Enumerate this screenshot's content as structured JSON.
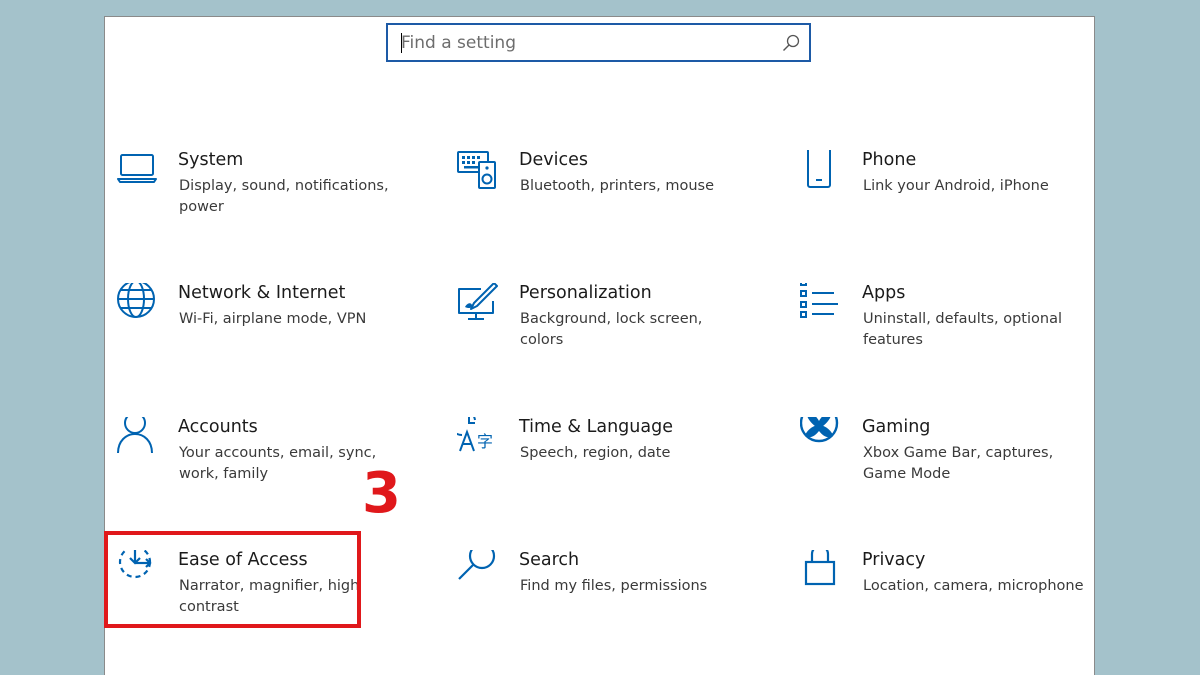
{
  "search": {
    "placeholder": "Find a setting"
  },
  "accent_color": "#0063b1",
  "annotation": {
    "number": "3",
    "color": "#e0181b"
  },
  "tiles": [
    {
      "title": "System",
      "desc": "Display, sound, notifications, power",
      "icon": "laptop-icon"
    },
    {
      "title": "Devices",
      "desc": "Bluetooth, printers, mouse",
      "icon": "keyboard-speaker-icon"
    },
    {
      "title": "Phone",
      "desc": "Link your Android, iPhone",
      "icon": "phone-icon"
    },
    {
      "title": "Network & Internet",
      "desc": "Wi-Fi, airplane mode, VPN",
      "icon": "globe-icon"
    },
    {
      "title": "Personalization",
      "desc": "Background, lock screen, colors",
      "icon": "paint-monitor-icon"
    },
    {
      "title": "Apps",
      "desc": "Uninstall, defaults, optional features",
      "icon": "apps-list-icon"
    },
    {
      "title": "Accounts",
      "desc": "Your accounts, email, sync, work, family",
      "icon": "person-icon"
    },
    {
      "title": "Time & Language",
      "desc": "Speech, region, date",
      "icon": "time-language-icon"
    },
    {
      "title": "Gaming",
      "desc": "Xbox Game Bar, captures, Game Mode",
      "icon": "xbox-icon"
    },
    {
      "title": "Ease of Access",
      "desc": "Narrator, magnifier, high contrast",
      "icon": "ease-of-access-icon"
    },
    {
      "title": "Search",
      "desc": "Find my files, permissions",
      "icon": "search-icon"
    },
    {
      "title": "Privacy",
      "desc": "Location, camera, microphone",
      "icon": "lock-icon"
    }
  ]
}
